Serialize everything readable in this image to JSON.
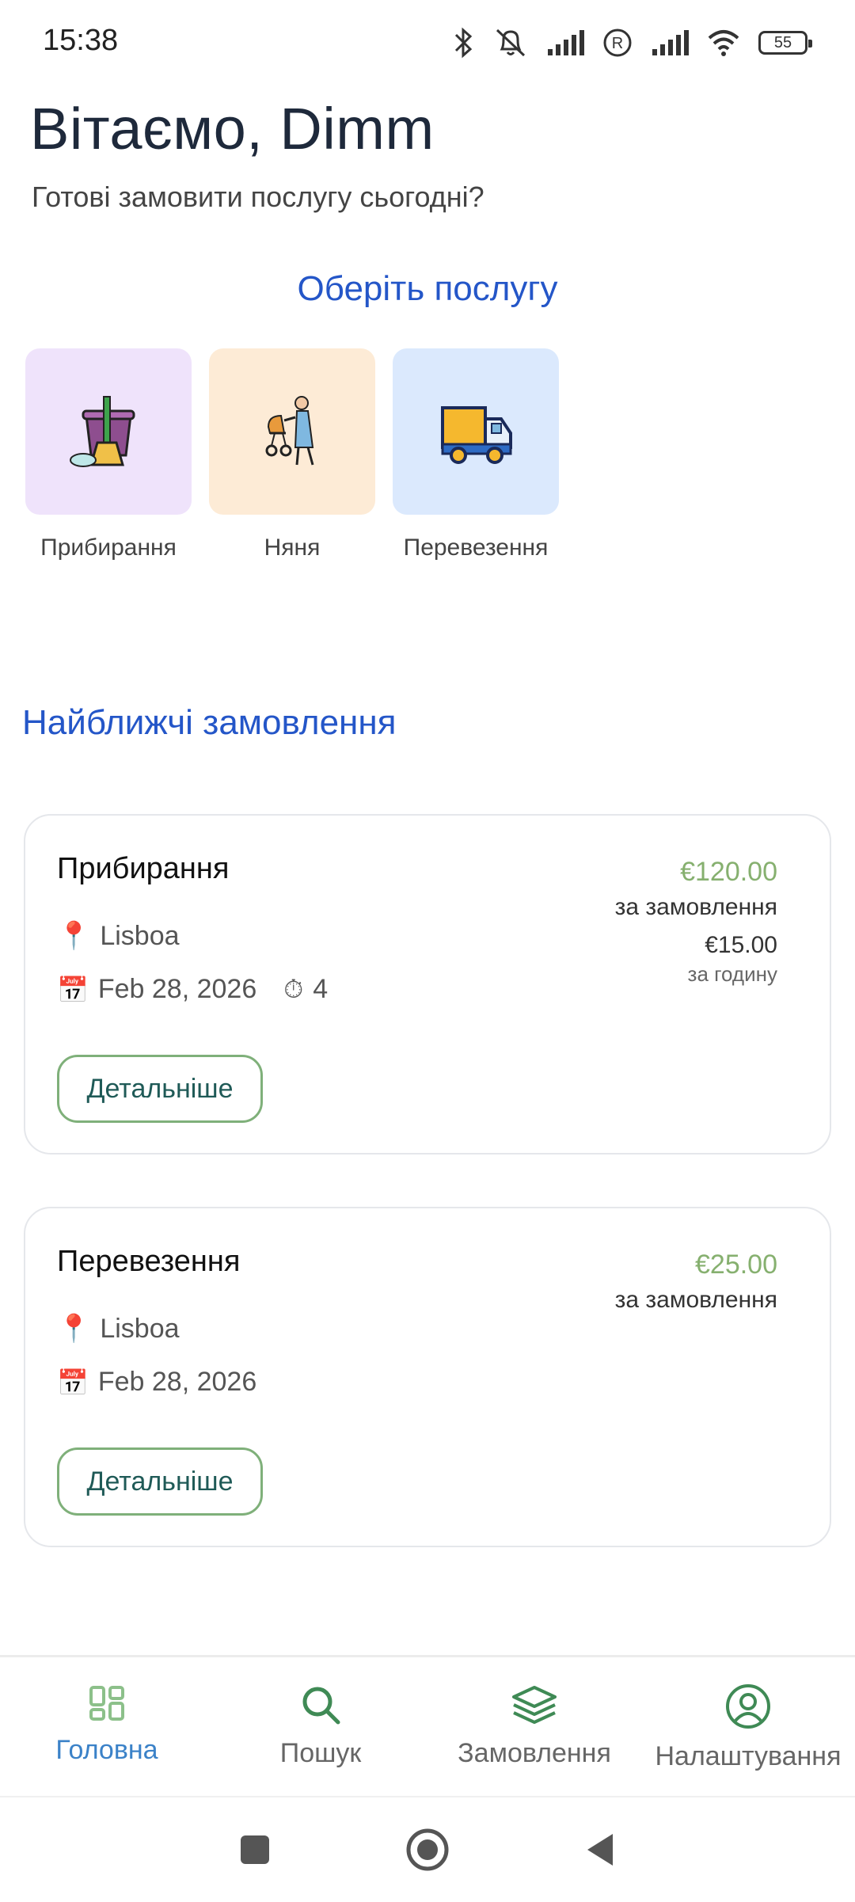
{
  "status": {
    "time": "15:38",
    "battery": "55"
  },
  "header": {
    "greeting": "Вітаємо, Dimm",
    "subtitle": "Готові замовити послугу сьогодні?"
  },
  "services_section": {
    "title": "Оберіть послугу",
    "items": [
      {
        "label": "Прибирання",
        "icon": "cleaning-bucket-icon",
        "bg": "#efe3fb"
      },
      {
        "label": "Няня",
        "icon": "nanny-stroller-icon",
        "bg": "#fdebd6"
      },
      {
        "label": "Перевезення",
        "icon": "delivery-truck-icon",
        "bg": "#dbe9fd"
      }
    ]
  },
  "orders_section": {
    "title": "Найближчі замовлення",
    "orders": [
      {
        "title": "Прибирання",
        "location": "Lisboa",
        "date": "Feb 28, 2026",
        "duration": "4",
        "price": "€120.00",
        "price_label": "за замовлення",
        "hourly": "€15.00",
        "hourly_label": "за годину",
        "button": "Детальніше"
      },
      {
        "title": "Перевезення",
        "location": "Lisboa",
        "date": "Feb 28, 2026",
        "price": "€25.00",
        "price_label": "за замовлення",
        "button": "Детальніше"
      }
    ]
  },
  "bottom_nav": {
    "items": [
      {
        "label": "Головна",
        "icon": "dashboard-icon",
        "active": true
      },
      {
        "label": "Пошук",
        "icon": "search-icon",
        "active": false
      },
      {
        "label": "Замовлення",
        "icon": "layers-icon",
        "active": false
      },
      {
        "label": "Налаштування",
        "icon": "user-circle-icon",
        "active": false
      }
    ]
  },
  "colors": {
    "accent_blue": "#2456c8",
    "price_green": "#86b06f",
    "button_border": "#7fb07a",
    "nav_icon_green": "#3f8a55",
    "nav_active": "#3b82c8"
  }
}
